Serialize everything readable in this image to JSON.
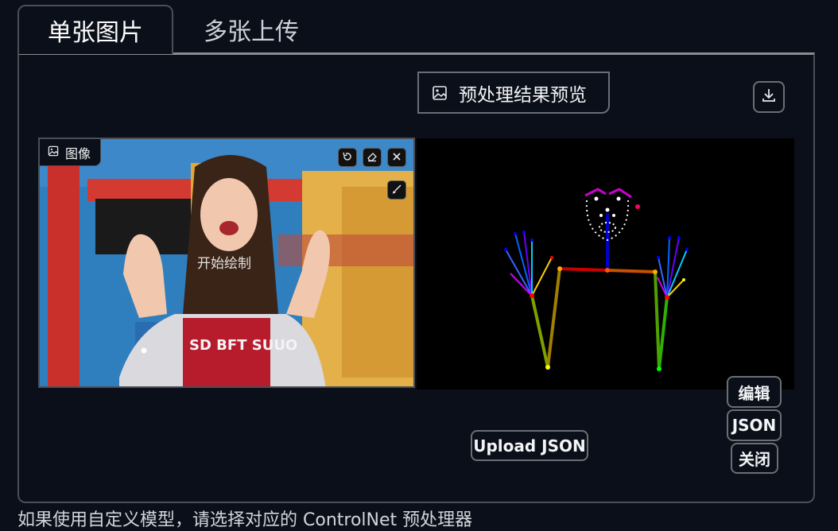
{
  "tabs": [
    {
      "label": "单张图片",
      "active": true
    },
    {
      "label": "多张上传",
      "active": false
    }
  ],
  "input_image": {
    "label": "图像",
    "draw_hint": "开始绘制",
    "tools": [
      "undo-icon",
      "eraser-icon",
      "close-icon",
      "brush-icon"
    ],
    "shirt_text": "SD BFT SUUO"
  },
  "preview": {
    "label": "预处理结果预览",
    "download_icon": "download-icon"
  },
  "pose_buttons": {
    "edit": "编辑",
    "json": "JSON",
    "close": "关闭"
  },
  "upload_json": "Upload JSON",
  "bottom_text": "如果使用自定义模型，请选择对应的 ControlNet 预处理器",
  "colors": {
    "background": "#0b0f19",
    "border": "#4b4e55",
    "text": "#e5e7eb"
  }
}
